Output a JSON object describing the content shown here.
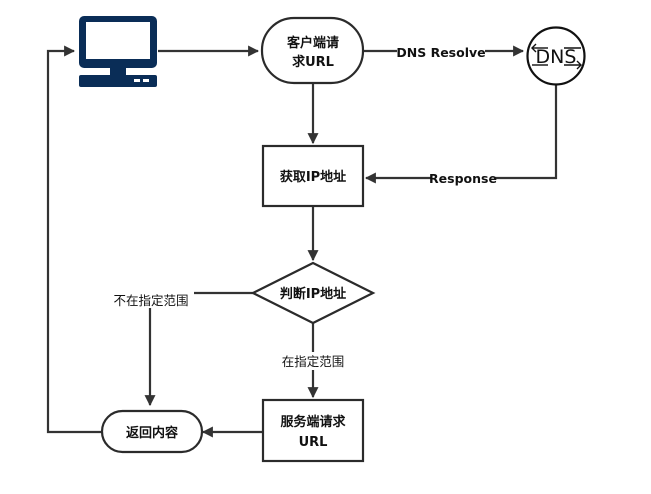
{
  "nodes": {
    "client_request": {
      "line1": "客户端请",
      "line2": "求URL"
    },
    "dns": {
      "label": "DNS"
    },
    "get_ip": {
      "label": "获取IP地址"
    },
    "judge_ip": {
      "label": "判断IP地址"
    },
    "server_request": {
      "line1": "服务端请求",
      "line2": "URL"
    },
    "return_content": {
      "label": "返回内容"
    }
  },
  "edges": {
    "dns_resolve": "DNS Resolve",
    "response": "Response",
    "out_of_range": "不在指定范围",
    "in_range": "在指定范围"
  },
  "icons": {
    "computer": "computer-monitor-icon",
    "dns": "dns-server-icon"
  },
  "colors": {
    "monitor": "#0a2d57",
    "stroke": "#2b2b2b"
  }
}
